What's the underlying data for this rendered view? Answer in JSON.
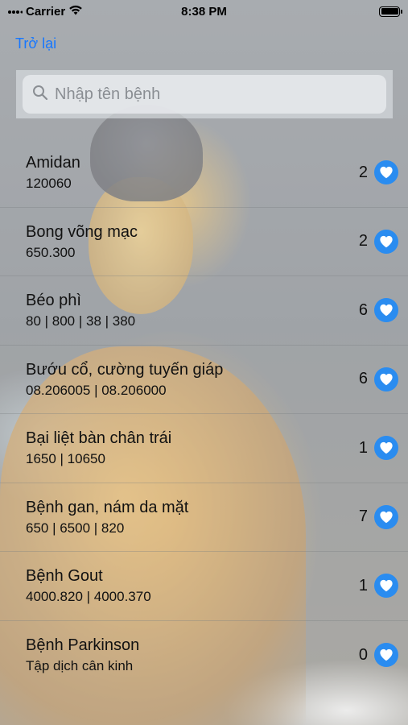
{
  "status_bar": {
    "carrier": "Carrier",
    "time": "8:38 PM",
    "battery_level": 1.0
  },
  "nav": {
    "back_label": "Trở lại"
  },
  "search": {
    "placeholder": "Nhập tên bệnh",
    "value": ""
  },
  "colors": {
    "accent": "#1677ff",
    "heart_button": "#2a8cf0"
  },
  "items": [
    {
      "title": "Amidan",
      "subtitle": "120060",
      "count": "2",
      "icon": "heart-icon"
    },
    {
      "title": "Bong võng mạc",
      "subtitle": "650.300",
      "count": "2",
      "icon": "heart-icon"
    },
    {
      "title": "Béo phì",
      "subtitle": "80 | 800 | 38 | 380",
      "count": "6",
      "icon": "heart-icon"
    },
    {
      "title": "Bướu cổ, cường tuyến giáp",
      "subtitle": "08.206005 | 08.206000",
      "count": "6",
      "icon": "heart-icon"
    },
    {
      "title": "Bại liệt bàn chân trái",
      "subtitle": "1650 | 10650",
      "count": "1",
      "icon": "heart-icon"
    },
    {
      "title": "Bệnh gan, nám da mặt",
      "subtitle": "650 | 6500 | 820",
      "count": "7",
      "icon": "heart-icon"
    },
    {
      "title": "Bệnh Gout",
      "subtitle": "4000.820 | 4000.370",
      "count": "1",
      "icon": "heart-icon"
    },
    {
      "title": "Bệnh Parkinson",
      "subtitle": "Tập dịch cân kinh",
      "count": "0",
      "icon": "heart-icon"
    }
  ]
}
